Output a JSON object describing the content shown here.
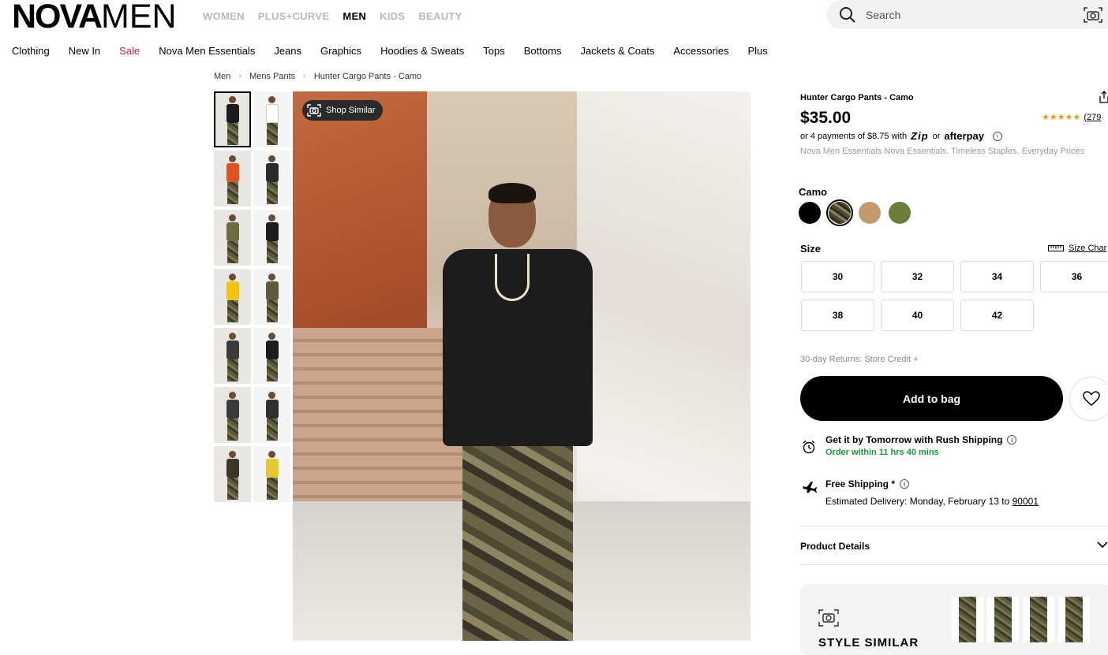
{
  "brand": {
    "logo_bold": "NOVA",
    "logo_light": "MEN"
  },
  "departments": [
    {
      "label": "WOMEN",
      "active": false
    },
    {
      "label": "PLUS+CURVE",
      "active": false
    },
    {
      "label": "MEN",
      "active": true
    },
    {
      "label": "KIDS",
      "active": false
    },
    {
      "label": "BEAUTY",
      "active": false
    }
  ],
  "search": {
    "placeholder": "Search"
  },
  "categories": [
    "Clothing",
    "New In",
    "Sale",
    "Nova Men Essentials",
    "Jeans",
    "Graphics",
    "Hoodies & Sweats",
    "Tops",
    "Bottoms",
    "Jackets & Coats",
    "Accessories",
    "Plus"
  ],
  "breadcrumb": [
    "Men",
    "Mens Pants",
    "Hunter Cargo Pants - Camo"
  ],
  "gallery": {
    "shop_similar_label": "Shop Similar",
    "thumb_count": 14,
    "thumb_torso_colors": [
      "#1c1c1c",
      "#ffffff",
      "#e0521f",
      "#2a2a2a",
      "#6d6c3f",
      "#1c1c1c",
      "#f1c40f",
      "#5e5a40",
      "#3a3a3a",
      "#1c1c1c",
      "#3a3a3a",
      "#2f2f2f",
      "#3b3726",
      "#e8c832"
    ]
  },
  "product": {
    "title": "Hunter Cargo Pants - Camo",
    "price": "$35.00",
    "rating_stars": "★★★★★",
    "rating_count": "(279",
    "payments_text": "or 4 payments of $8.75 with",
    "zip_label": "Zip",
    "or_text": "or",
    "afterpay_label": "afterpay",
    "tagline": "Nova Men Essentials Nova Essentials. Timeless Staples, Everyday Prices",
    "color_label": "Camo",
    "swatches": [
      {
        "name": "black",
        "color": "#000000",
        "selected": false
      },
      {
        "name": "camo",
        "color": "#6c6a48",
        "selected": true
      },
      {
        "name": "khaki",
        "color": "#c39a6e",
        "selected": false
      },
      {
        "name": "olive",
        "color": "#6b7f3a",
        "selected": false
      }
    ],
    "size_label": "Size",
    "size_chart_label": "Size Char",
    "sizes": [
      "30",
      "32",
      "34",
      "36",
      "38",
      "40",
      "42"
    ],
    "returns_text": "30-day Returns: Store Credit +",
    "add_to_bag_label": "Add to bag"
  },
  "shipping": {
    "rush_title": "Get it by Tomorrow with Rush Shipping",
    "rush_countdown": "Order within 11 hrs 40 mins",
    "free_title": "Free Shipping *",
    "delivery_text": "Estimated Delivery: Monday, February 13 to",
    "zip_code": "90001"
  },
  "details": {
    "label": "Product Details"
  },
  "similar": {
    "title": "STYLE SIMILAR",
    "item_count": 4
  }
}
